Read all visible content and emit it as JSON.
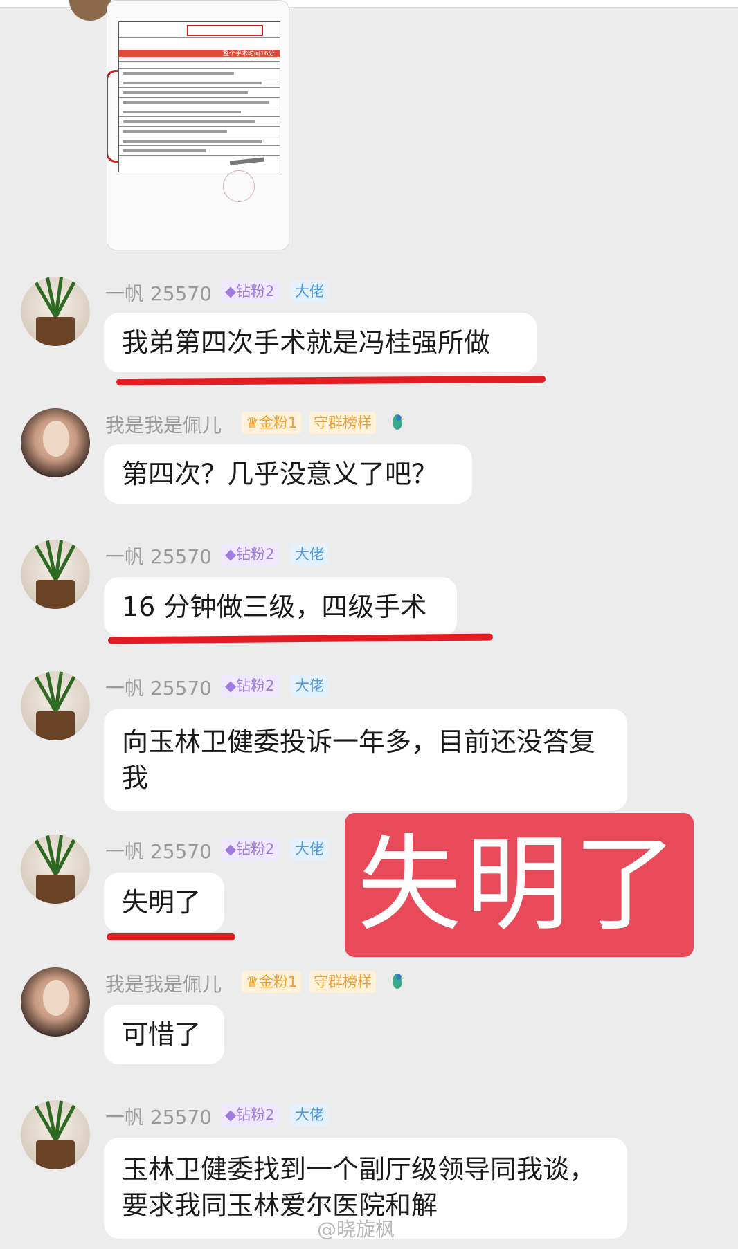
{
  "users": {
    "yifan": {
      "name": "一帆 25570",
      "badges": [
        "钻粉2",
        "大佬"
      ]
    },
    "peier": {
      "name": "我是我是佩儿",
      "badges": [
        "金粉1",
        "守群榜样"
      ]
    }
  },
  "messages": [
    {
      "user": "yifan",
      "text": "我弟第四次手术就是冯桂强所做",
      "underlined": true
    },
    {
      "user": "peier",
      "text": "第四次？几乎没意义了吧？",
      "underlined": false
    },
    {
      "user": "yifan",
      "text": "16 分钟做三级，四级手术",
      "underlined": true
    },
    {
      "user": "yifan",
      "text": "向玉林卫健委投诉一年多，目前还没答复我",
      "underlined": false
    },
    {
      "user": "yifan",
      "text": "失明了",
      "underlined": true
    },
    {
      "user": "peier",
      "text": "可惜了",
      "underlined": false
    },
    {
      "user": "yifan",
      "text": "玉林卫健委找到一个副厅级领导同我谈，要求我同玉林爱尔医院和解",
      "underlined": false
    }
  ],
  "overlay_caption": "失明了",
  "document_image": {
    "highlight_label": "整个手术时间16分钟"
  },
  "watermark": "@晓旋枫",
  "colors": {
    "background": "#ececec",
    "bubble": "#ffffff",
    "underline": "#e31c23",
    "overlay": "#e84a5a",
    "badge_zuan": "#a07be0",
    "badge_dalao": "#4c9ae0",
    "badge_jin": "#f2a12e"
  },
  "icons": {
    "badge_zuan": "diamond-icon",
    "badge_jin": "crown-icon",
    "bird": "parrot-icon"
  }
}
